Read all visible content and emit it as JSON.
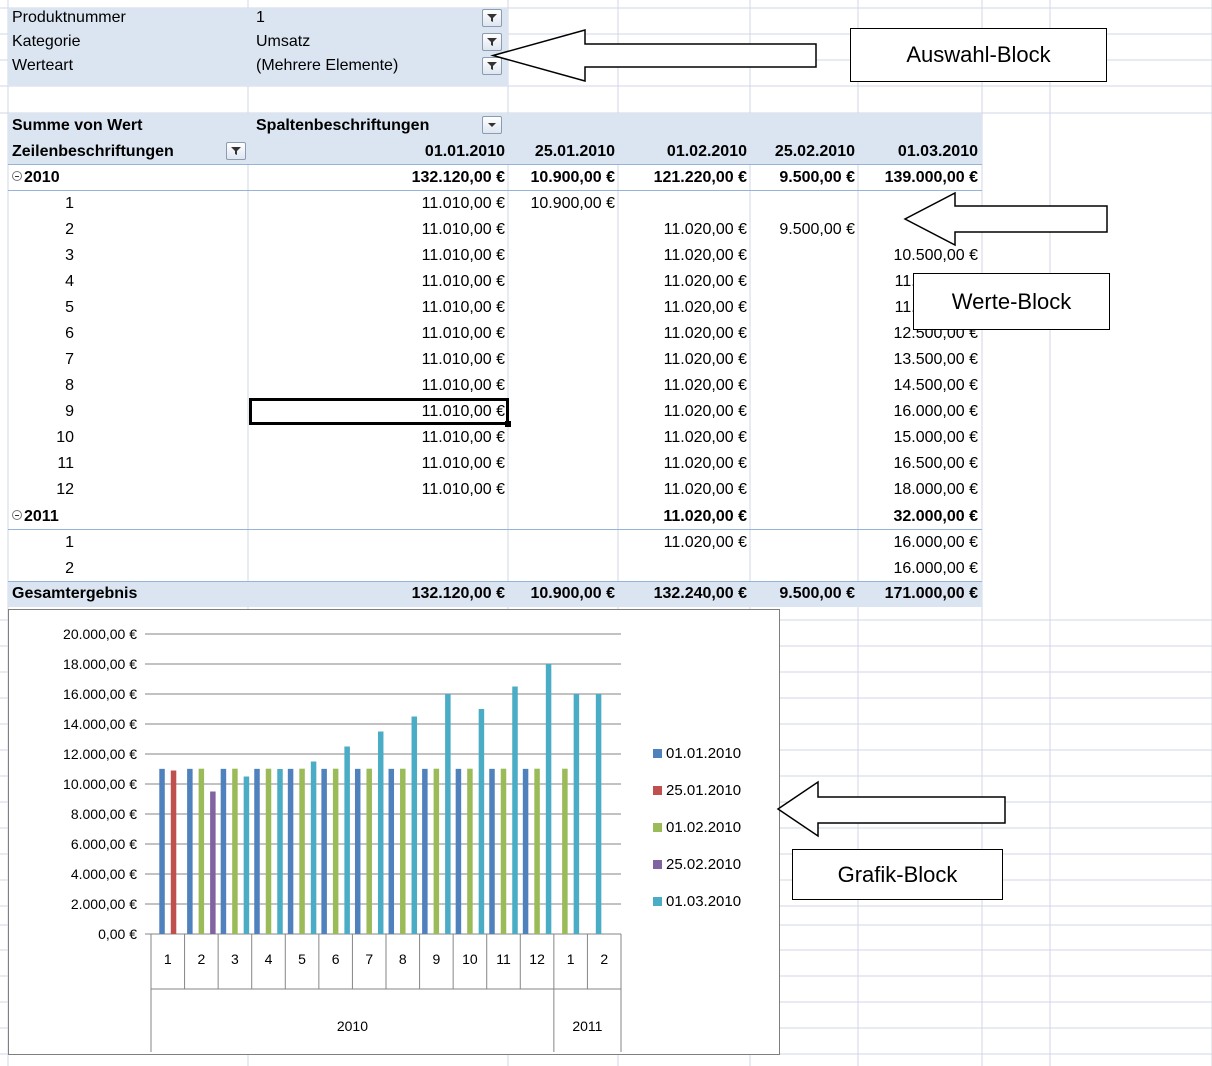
{
  "filters": [
    {
      "label": "Produktnummer",
      "value": "1"
    },
    {
      "label": "Kategorie",
      "value": "Umsatz"
    },
    {
      "label": "Werteart",
      "value": "(Mehrere Elemente)"
    }
  ],
  "pivot": {
    "values_label": "Summe von Wert",
    "column_labels": "Spaltenbeschriftungen",
    "row_labels": "Zeilenbeschriftungen",
    "columns": [
      "01.01.2010",
      "25.01.2010",
      "01.02.2010",
      "25.02.2010",
      "01.03.2010"
    ],
    "groups": [
      {
        "year": "2010",
        "totals": [
          "132.120,00 €",
          "10.900,00 €",
          "121.220,00 €",
          "9.500,00 €",
          "139.000,00 €"
        ],
        "rows": [
          {
            "label": "1",
            "values": [
              "11.010,00 €",
              "10.900,00 €",
              "",
              "",
              ""
            ]
          },
          {
            "label": "2",
            "values": [
              "11.010,00 €",
              "",
              "11.020,00 €",
              "9.500,00 €",
              ""
            ]
          },
          {
            "label": "3",
            "values": [
              "11.010,00 €",
              "",
              "11.020,00 €",
              "",
              "10.500,00 €"
            ]
          },
          {
            "label": "4",
            "values": [
              "11.010,00 €",
              "",
              "11.020,00 €",
              "",
              "11.000,00 €"
            ]
          },
          {
            "label": "5",
            "values": [
              "11.010,00 €",
              "",
              "11.020,00 €",
              "",
              "11.500,00 €"
            ]
          },
          {
            "label": "6",
            "values": [
              "11.010,00 €",
              "",
              "11.020,00 €",
              "",
              "12.500,00 €"
            ]
          },
          {
            "label": "7",
            "values": [
              "11.010,00 €",
              "",
              "11.020,00 €",
              "",
              "13.500,00 €"
            ]
          },
          {
            "label": "8",
            "values": [
              "11.010,00 €",
              "",
              "11.020,00 €",
              "",
              "14.500,00 €"
            ]
          },
          {
            "label": "9",
            "values": [
              "11.010,00 €",
              "",
              "11.020,00 €",
              "",
              "16.000,00 €"
            ]
          },
          {
            "label": "10",
            "values": [
              "11.010,00 €",
              "",
              "11.020,00 €",
              "",
              "15.000,00 €"
            ]
          },
          {
            "label": "11",
            "values": [
              "11.010,00 €",
              "",
              "11.020,00 €",
              "",
              "16.500,00 €"
            ]
          },
          {
            "label": "12",
            "values": [
              "11.010,00 €",
              "",
              "11.020,00 €",
              "",
              "18.000,00 €"
            ]
          }
        ]
      },
      {
        "year": "2011",
        "totals": [
          "",
          "",
          "11.020,00 €",
          "",
          "32.000,00 €"
        ],
        "rows": [
          {
            "label": "1",
            "values": [
              "",
              "",
              "11.020,00 €",
              "",
              "16.000,00 €"
            ]
          },
          {
            "label": "2",
            "values": [
              "",
              "",
              "",
              "",
              "16.000,00 €"
            ]
          }
        ]
      }
    ],
    "grand_total_label": "Gesamtergebnis",
    "grand_totals": [
      "132.120,00 €",
      "10.900,00 €",
      "132.240,00 €",
      "9.500,00 €",
      "171.000,00 €"
    ]
  },
  "callouts": {
    "auswahl": "Auswahl-Block",
    "werte": "Werte-Block",
    "grafik": "Grafik-Block"
  },
  "chart_data": {
    "type": "bar",
    "categories": [
      "1",
      "2",
      "3",
      "4",
      "5",
      "6",
      "7",
      "8",
      "9",
      "10",
      "11",
      "12",
      "1",
      "2"
    ],
    "category_groups": [
      {
        "label": "2010",
        "count": 12
      },
      {
        "label": "2011",
        "count": 2
      }
    ],
    "series": [
      {
        "name": "01.01.2010",
        "color": "#4f81bd",
        "values": [
          11010,
          11010,
          11010,
          11010,
          11010,
          11010,
          11010,
          11010,
          11010,
          11010,
          11010,
          11010,
          null,
          null
        ]
      },
      {
        "name": "25.01.2010",
        "color": "#c0504d",
        "values": [
          10900,
          null,
          null,
          null,
          null,
          null,
          null,
          null,
          null,
          null,
          null,
          null,
          null,
          null
        ]
      },
      {
        "name": "01.02.2010",
        "color": "#9bbb59",
        "values": [
          null,
          11020,
          11020,
          11020,
          11020,
          11020,
          11020,
          11020,
          11020,
          11020,
          11020,
          11020,
          11020,
          null
        ]
      },
      {
        "name": "25.02.2010",
        "color": "#8064a2",
        "values": [
          null,
          9500,
          null,
          null,
          null,
          null,
          null,
          null,
          null,
          null,
          null,
          null,
          null,
          null
        ]
      },
      {
        "name": "01.03.2010",
        "color": "#4bacc6",
        "values": [
          null,
          null,
          10500,
          11000,
          11500,
          12500,
          13500,
          14500,
          16000,
          15000,
          16500,
          18000,
          16000,
          16000
        ]
      }
    ],
    "ylim": [
      0,
      20000
    ],
    "yticks": [
      "0,00 €",
      "2.000,00 €",
      "4.000,00 €",
      "6.000,00 €",
      "8.000,00 €",
      "10.000,00 €",
      "12.000,00 €",
      "14.000,00 €",
      "16.000,00 €",
      "18.000,00 €",
      "20.000,00 €"
    ],
    "grid": true,
    "legend": "right",
    "title": "",
    "xlabel": "",
    "ylabel": ""
  }
}
